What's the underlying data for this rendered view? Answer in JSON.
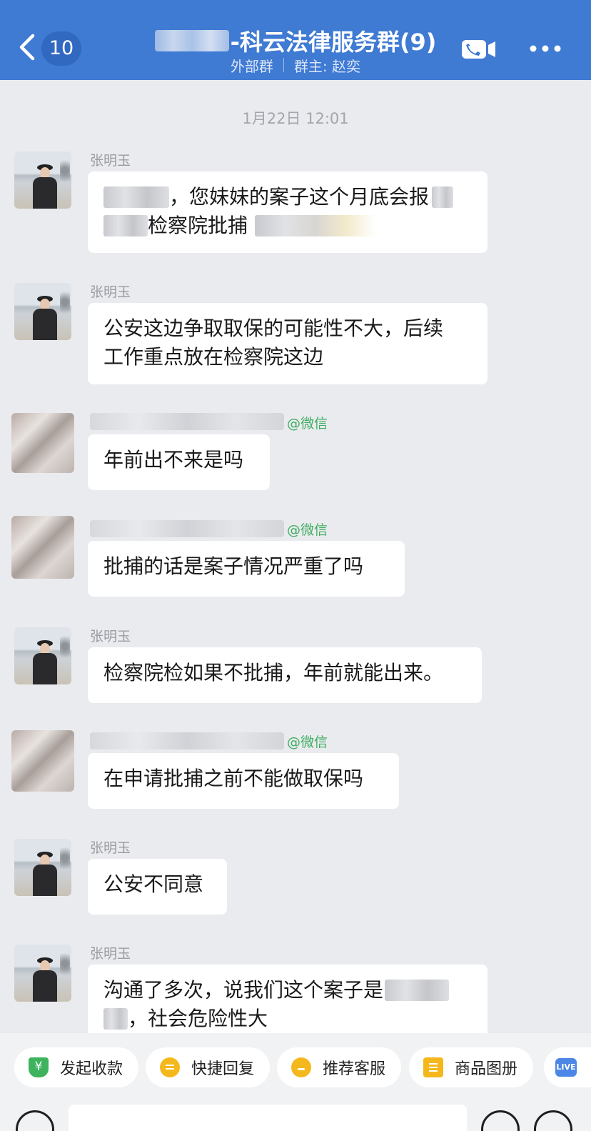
{
  "header": {
    "unread_count": "10",
    "title": "-科云法律服务群(9)",
    "subtitle_left": "外部群",
    "subtitle_right": "群主: 赵奕",
    "accent_color": "#3f7ad3",
    "icons": [
      "back-chevron-icon",
      "video-call-icon",
      "more-icon"
    ]
  },
  "timestamp": "1月22日 12:01",
  "wechat_tag": "@微信",
  "messages": [
    {
      "sender": "张明玉",
      "lines": [
        [
          "，您妹妹的案子这个月底会报"
        ],
        [
          "检察院批捕"
        ]
      ]
    },
    {
      "sender": "张明玉",
      "lines": [
        [
          "公安这边争取取保的可能性不大，后续"
        ],
        [
          "工作重点放在检察院这边"
        ]
      ]
    },
    {
      "sender": "",
      "lines": [
        [
          "年前出不来是吗"
        ]
      ]
    },
    {
      "sender": "",
      "lines": [
        [
          "批捕的话是案子情况严重了吗"
        ]
      ]
    },
    {
      "sender": "张明玉",
      "lines": [
        [
          "检察院检如果不批捕，年前就能出来。"
        ]
      ]
    },
    {
      "sender": "",
      "lines": [
        [
          "在申请批捕之前不能做取保吗"
        ]
      ]
    },
    {
      "sender": "张明玉",
      "lines": [
        [
          "公安不同意"
        ]
      ]
    },
    {
      "sender": "张明玉",
      "lines": [
        [
          "沟通了多次，说我们这个案子是"
        ],
        [
          "，社会危险性大"
        ]
      ]
    }
  ],
  "quick_actions": [
    {
      "label": "发起收款",
      "icon": "payment-icon"
    },
    {
      "label": "快捷回复",
      "icon": "quick-reply-icon"
    },
    {
      "label": "推荐客服",
      "icon": "service-icon"
    },
    {
      "label": "商品图册",
      "icon": "album-icon"
    }
  ],
  "live_label": "LIVE"
}
